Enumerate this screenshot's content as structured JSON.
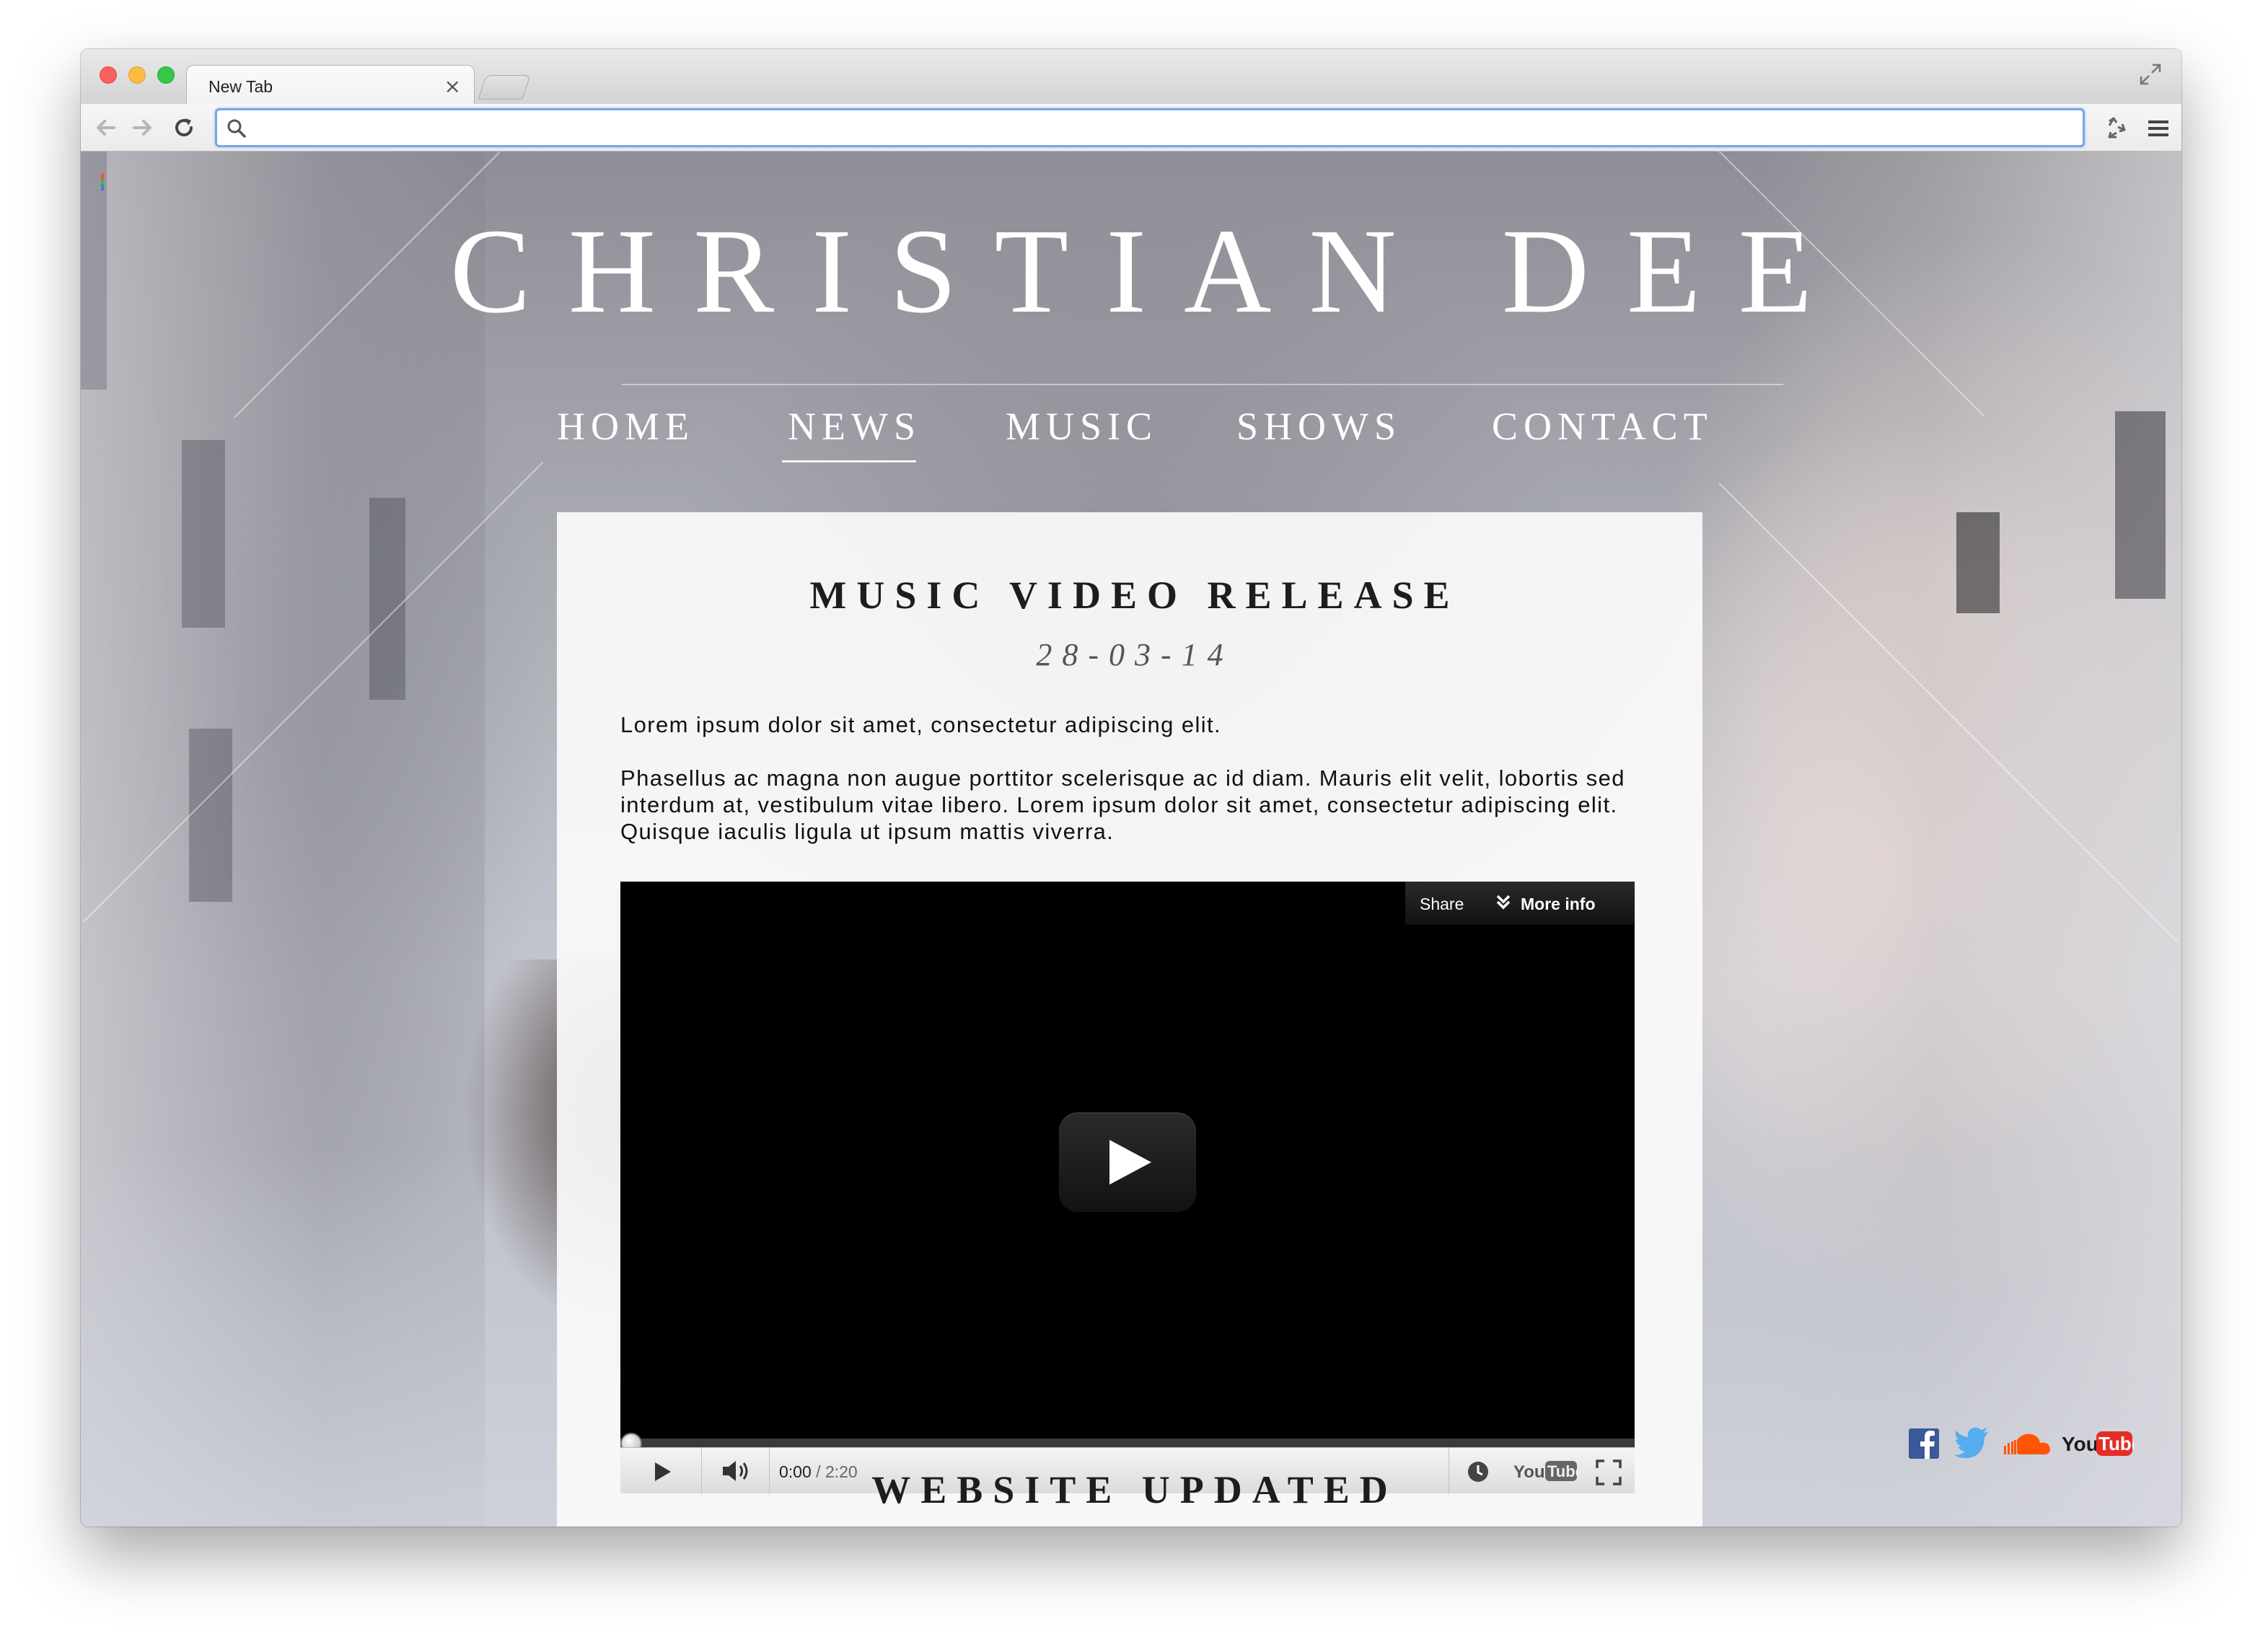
{
  "browser": {
    "tab_title": "New Tab",
    "tab_close": "×",
    "omnibox_value": "",
    "icons": [
      "back-icon",
      "forward-icon",
      "reload-icon",
      "search-icon",
      "extension-icon",
      "menu-icon",
      "fullscreen-icon"
    ]
  },
  "site": {
    "title": "CHRISTIAN DEE",
    "nav": [
      {
        "label": "HOME",
        "active": false
      },
      {
        "label": "NEWS",
        "active": true
      },
      {
        "label": "MUSIC",
        "active": false
      },
      {
        "label": "SHOWS",
        "active": false
      },
      {
        "label": "CONTACT",
        "active": false
      }
    ],
    "post": {
      "title": "MUSIC VIDEO RELEASE",
      "date": "28-03-14",
      "paragraph_1": "Lorem ipsum dolor sit amet, consectetur adipiscing elit.",
      "paragraph_2": "Phasellus ac magna non augue porttitor scelerisque ac id diam. Mauris elit velit, lobortis sed interdum at, vestibulum vitae libero. Lorem ipsum dolor sit amet, consectetur adipiscing elit. Quisque iaculis ligula ut ipsum mattis viverra."
    },
    "video": {
      "share_label": "Share",
      "more_info_label": "More info",
      "current_time": "0:00",
      "time_separator": " / ",
      "duration": "2:20",
      "progress": 0,
      "youtube_logo": "YouTube"
    },
    "next_post_title": "WEBSITE UPDATED",
    "social": [
      {
        "name": "facebook-icon",
        "color": "#3b5998"
      },
      {
        "name": "twitter-icon",
        "color": "#55acee"
      },
      {
        "name": "soundcloud-icon",
        "color": "#ff5500"
      },
      {
        "name": "youtube-icon",
        "color": "#e52d27",
        "text_you": "You",
        "text_tube": "Tube"
      }
    ]
  }
}
